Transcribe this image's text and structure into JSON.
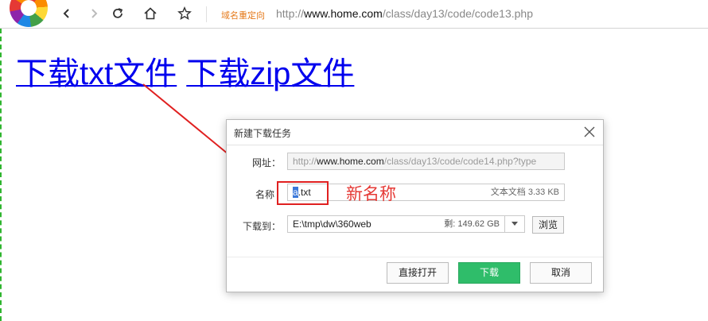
{
  "browser": {
    "redirect_label": "域名重定向",
    "url_gray_prefix": "http://",
    "url_host": "www.home.com",
    "url_path": "/class/day13/code/code13.php"
  },
  "page": {
    "link_txt": "下载txt文件",
    "link_zip": "下载zip文件"
  },
  "dialog": {
    "title": "新建下载任务",
    "url_label": "网址：",
    "url_prefix": "http://",
    "url_host": "www.home.com",
    "url_path": "/class/day13/code/code14.php?type",
    "name_label": "名称",
    "name_selected": "a",
    "name_rest": ".txt",
    "name_info": "文本文档 3.33 KB",
    "path_label": "下载到：",
    "path_value": "E:\\tmp\\dw\\360web",
    "free_space": "剩: 149.62 GB",
    "browse_label": "浏览",
    "open_label": "直接打开",
    "download_label": "下载",
    "cancel_label": "取消"
  },
  "annotation": {
    "text": "新名称",
    "color": "#e53935"
  },
  "icons": [
    "browser-logo-icon",
    "back-icon",
    "forward-icon",
    "refresh-icon",
    "home-icon",
    "star-icon",
    "close-icon",
    "chevron-down-icon"
  ]
}
